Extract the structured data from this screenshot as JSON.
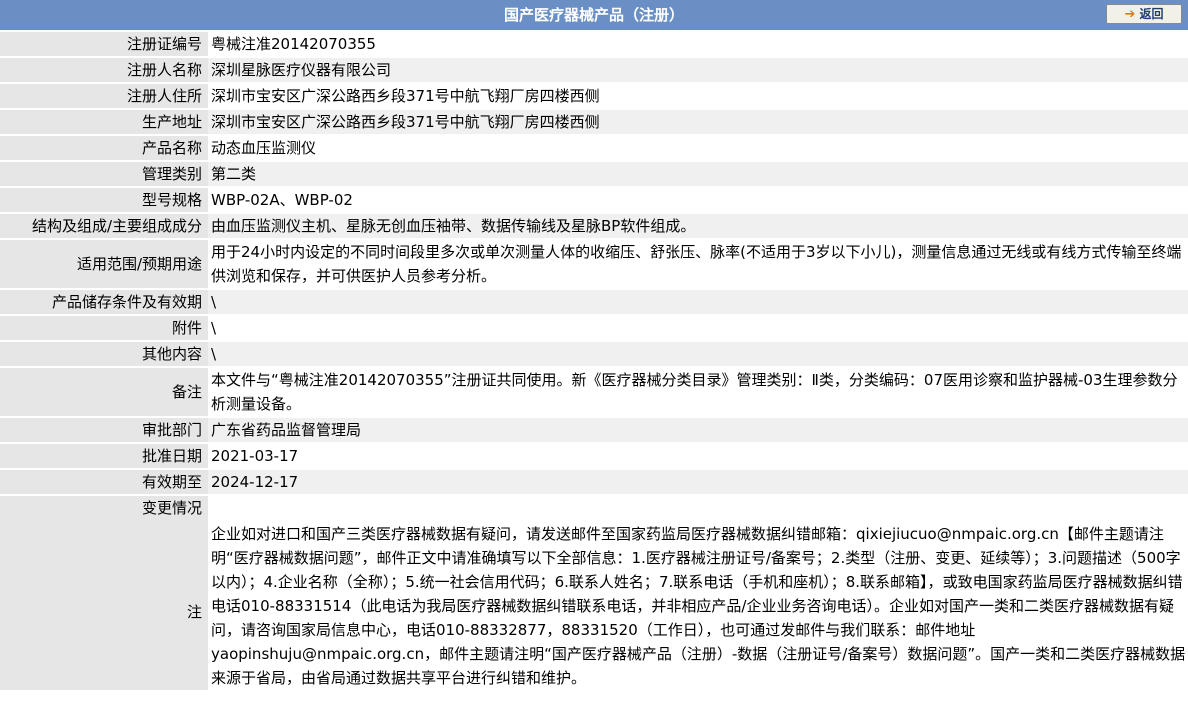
{
  "page": {
    "title": "国产医疗器械产品（注册）",
    "back_label": "返回"
  },
  "rows": [
    {
      "label": "注册证编号",
      "value": "粤械注准20142070355"
    },
    {
      "label": "注册人名称",
      "value": "深圳星脉医疗仪器有限公司"
    },
    {
      "label": "注册人住所",
      "value": "深圳市宝安区广深公路西乡段371号中航飞翔厂房四楼西侧"
    },
    {
      "label": "生产地址",
      "value": "深圳市宝安区广深公路西乡段371号中航飞翔厂房四楼西侧"
    },
    {
      "label": "产品名称",
      "value": "动态血压监测仪"
    },
    {
      "label": "管理类别",
      "value": "第二类"
    },
    {
      "label": "型号规格",
      "value": "WBP-02A、WBP-02"
    },
    {
      "label": "结构及组成/主要组成成分",
      "value": "由血压监测仪主机、星脉无创血压袖带、数据传输线及星脉BP软件组成。"
    },
    {
      "label": "适用范围/预期用途",
      "value": "用于24小时内设定的不同时间段里多次或单次测量人体的收缩压、舒张压、脉率(不适用于3岁以下小儿)，测量信息通过无线或有线方式传输至终端供浏览和保存，并可供医护人员参考分析。"
    },
    {
      "label": "产品储存条件及有效期",
      "value": "\\"
    },
    {
      "label": "附件",
      "value": "\\"
    },
    {
      "label": "其他内容",
      "value": "\\"
    },
    {
      "label": "备注",
      "value": "本文件与“粤械注准20142070355”注册证共同使用。新《医疗器械分类目录》管理类别：Ⅱ类，分类编码：07医用诊察和监护器械-03生理参数分析测量设备。"
    },
    {
      "label": "审批部门",
      "value": "广东省药品监督管理局"
    },
    {
      "label": "批准日期",
      "value": "2021-03-17"
    },
    {
      "label": "有效期至",
      "value": "2024-12-17"
    },
    {
      "label": "变更情况",
      "value": ""
    }
  ],
  "note": {
    "label": "注",
    "text": "企业如对进口和国产三类医疗器械数据有疑问，请发送邮件至国家药监局医疗器械数据纠错邮箱：qixiejiucuo@nmpaic.org.cn【邮件主题请注明“医疗器械数据问题”，邮件正文中请准确填写以下全部信息：1.医疗器械注册证号/备案号；2.类型（注册、变更、延续等）；3.问题描述（500字以内）；4.企业名称（全称）；5.统一社会信用代码；6.联系人姓名；7.联系电话（手机和座机）；8.联系邮箱】，或致电国家药监局医疗器械数据纠错电话010-88331514（此电话为我局医疗器械数据纠错联系电话，并非相应产品/企业业务咨询电话）。企业如对国产一类和二类医疗器械数据有疑问，请咨询国家局信息中心，电话010-88332877，88331520（工作日），也可通过发邮件与我们联系：邮件地址yaopinshuju@nmpaic.org.cn，邮件主题请注明“国产医疗器械产品（注册）-数据（注册证号/备案号）数据问题”。国产一类和二类医疗器械数据来源于省局，由省局通过数据共享平台进行纠错和维护。"
  }
}
